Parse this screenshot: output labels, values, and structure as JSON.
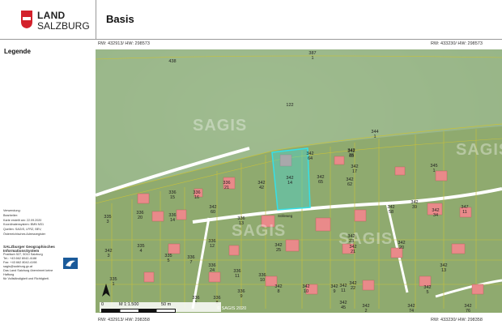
{
  "logo": {
    "line1": "LAND",
    "line2": "SALZBURG"
  },
  "title": "Basis",
  "legend": {
    "title": "Legende"
  },
  "metadata": {
    "lines": [
      "Verwendung:",
      "Bearbeiter:",
      "Karte erstellt am: 22.09.2020",
      "Koordinatensystem: BMN M31",
      "Quellen: SAGIS, LFRZ, BEV,",
      "Österreichisches Adressregister"
    ]
  },
  "org": {
    "lines": [
      "SALZburger Geographisches",
      "InformationsSystem",
      "Postfach 527, 5010 Salzburg",
      "Tel.: +43 662 8042-4188",
      "Fax: +43 662 8042-4198",
      "sagis@salzburg.gv.at",
      "Das Land Salzburg übernimmt keine Haftung",
      "für Vollständigkeit und Richtigkeit."
    ]
  },
  "coordinates": {
    "top_left": "RW: 432913/ HW: 298573",
    "top_right": "RW: 433230/ HW: 298573",
    "bottom_left": "RW: 432913/ HW: 298358",
    "bottom_right": "RW: 433230/ HW: 298358"
  },
  "map": {
    "watermark": "SAGIS",
    "road_label": "Sölleweg",
    "scale": {
      "ratio": "M 1:1.500",
      "start": "0",
      "end": "50 m"
    },
    "copyright": "© SAGIS 2020",
    "parcels": [
      {
        "label": "438"
      },
      {
        "label": "387\n1"
      },
      {
        "label": "122"
      },
      {
        "label": "344\n1"
      },
      {
        "label": "342\n36"
      },
      {
        "label": "342\n64"
      },
      {
        "label": "342\n63"
      },
      {
        "label": "342\n17"
      },
      {
        "label": "342\n14"
      },
      {
        "label": "342\n65"
      },
      {
        "label": "342\n62"
      },
      {
        "label": "342\n42"
      },
      {
        "label": "345\n1"
      },
      {
        "label": "336\n15"
      },
      {
        "label": "336\n16"
      },
      {
        "label": "336\n21"
      },
      {
        "label": "335\n3"
      },
      {
        "label": "336\n20"
      },
      {
        "label": "336\n14"
      },
      {
        "label": "342\n60"
      },
      {
        "label": "342\n58"
      },
      {
        "label": "342\n39"
      },
      {
        "label": "342\n34"
      },
      {
        "label": "347\n11"
      },
      {
        "label": "336\n13"
      },
      {
        "label": "336\n12"
      },
      {
        "label": "342\n25"
      },
      {
        "label": "342\n23"
      },
      {
        "label": "342\n21"
      },
      {
        "label": "342\n20"
      },
      {
        "label": "342\n13"
      },
      {
        "label": "342\n3"
      },
      {
        "label": "335\n4"
      },
      {
        "label": "335\n5"
      },
      {
        "label": "336\n7"
      },
      {
        "label": "336\n24"
      },
      {
        "label": "336\n11"
      },
      {
        "label": "336\n10"
      },
      {
        "label": "342\n22"
      },
      {
        "label": "342\n11"
      },
      {
        "label": "342\n8"
      },
      {
        "label": "342\n10"
      },
      {
        "label": "342\n9"
      },
      {
        "label": "342\n45"
      },
      {
        "label": "342\n2"
      },
      {
        "label": "342\n74"
      },
      {
        "label": "342\n76"
      },
      {
        "label": "342\n5"
      },
      {
        "label": "335\n1"
      },
      {
        "label": "336\n1"
      },
      {
        "label": "336\n8"
      },
      {
        "label": "336\n9"
      }
    ]
  },
  "colors": {
    "highlight": "#35e0e8",
    "parcel_line": "#c8c23a",
    "building": "#e98a8a",
    "road": "#ffffff"
  }
}
